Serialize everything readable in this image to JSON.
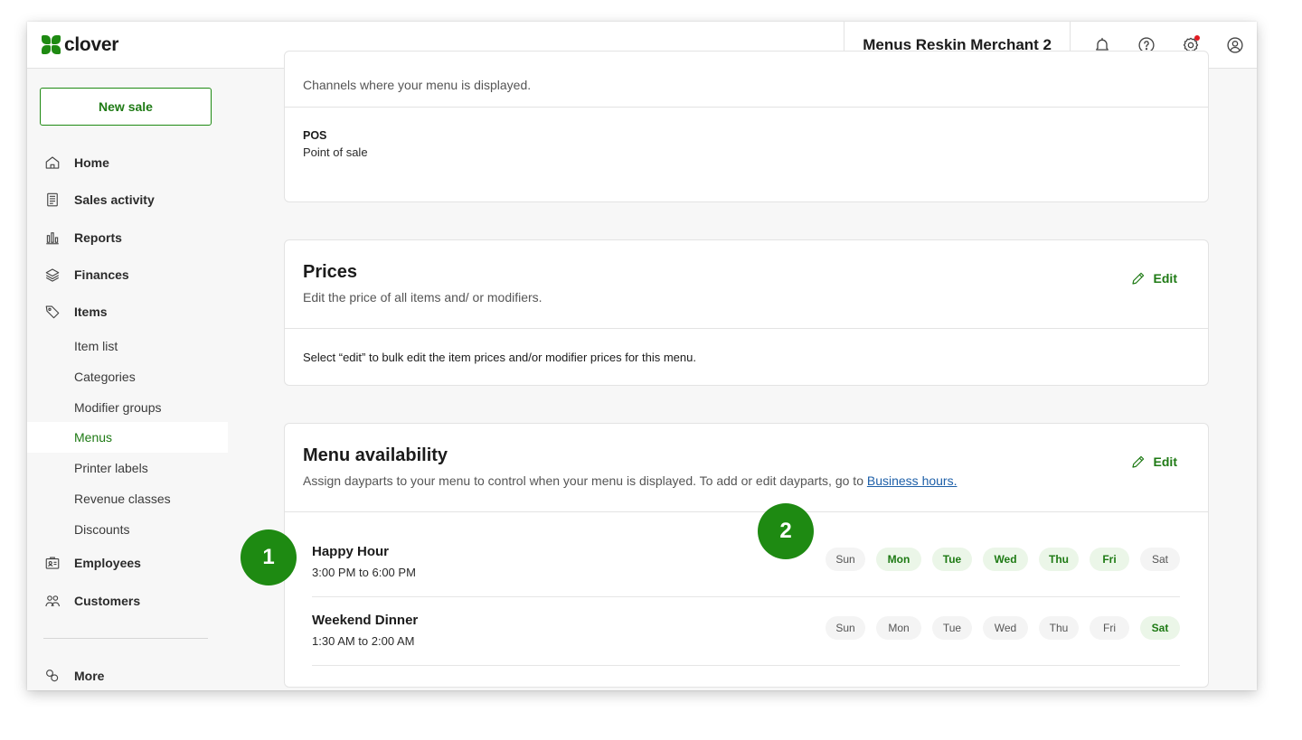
{
  "app": {
    "logo_text": "clover",
    "merchant_name": "Menus Reskin Merchant 2",
    "accent_color": "#1e8a12"
  },
  "topbar": {
    "icons": [
      "bell-icon",
      "help-icon",
      "settings-icon",
      "account-icon"
    ]
  },
  "sidebar": {
    "new_sale": "New sale",
    "items": {
      "home": "Home",
      "sales_activity": "Sales activity",
      "reports": "Reports",
      "finances": "Finances",
      "items": "Items",
      "employees": "Employees",
      "customers": "Customers",
      "more": "More"
    },
    "sub_items": {
      "item_list": "Item list",
      "categories": "Categories",
      "modifier_groups": "Modifier groups",
      "menus": "Menus",
      "printer_labels": "Printer labels",
      "revenue_classes": "Revenue classes",
      "discounts": "Discounts"
    },
    "active": "Menus"
  },
  "channels": {
    "description": "Channels where your menu is displayed.",
    "pos_title": "POS",
    "pos_subtitle": "Point of sale"
  },
  "prices": {
    "title": "Prices",
    "description": "Edit the price of all items and/ or modifiers.",
    "edit_label": "Edit",
    "body": "Select “edit” to bulk edit the item prices and/or modifier prices for this menu."
  },
  "availability": {
    "title": "Menu availability",
    "description": "Assign dayparts to your menu to control when your menu is displayed. To add or edit dayparts, go to",
    "link": "Business hours.",
    "edit_label": "Edit",
    "dayparts": [
      {
        "name": "Happy Hour",
        "time": "3:00 PM to 6:00 PM",
        "days": [
          {
            "label": "Sun",
            "active": false
          },
          {
            "label": "Mon",
            "active": true
          },
          {
            "label": "Tue",
            "active": true
          },
          {
            "label": "Wed",
            "active": true
          },
          {
            "label": "Thu",
            "active": true
          },
          {
            "label": "Fri",
            "active": true
          },
          {
            "label": "Sat",
            "active": false
          }
        ]
      },
      {
        "name": "Weekend Dinner",
        "time": "1:30 AM to 2:00 AM",
        "days": [
          {
            "label": "Sun",
            "active": false
          },
          {
            "label": "Mon",
            "active": false
          },
          {
            "label": "Tue",
            "active": false
          },
          {
            "label": "Wed",
            "active": false
          },
          {
            "label": "Thu",
            "active": false
          },
          {
            "label": "Fri",
            "active": false
          },
          {
            "label": "Sat",
            "active": true
          }
        ]
      }
    ]
  },
  "markers": {
    "one": "1",
    "two": "2"
  }
}
